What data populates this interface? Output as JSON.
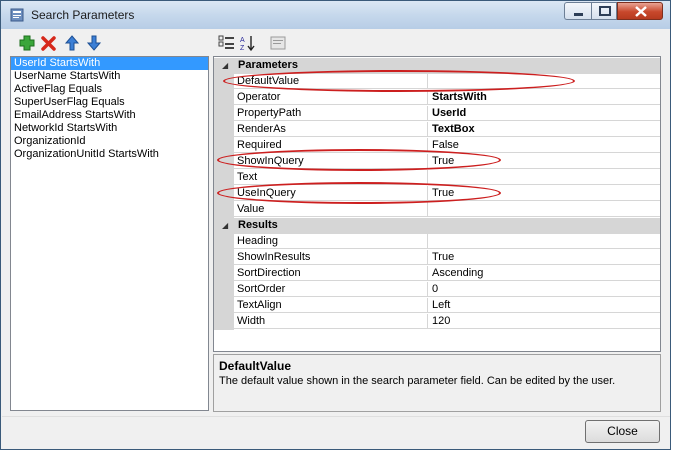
{
  "window": {
    "title": "Search Parameters"
  },
  "list": {
    "items": [
      "UserId StartsWith",
      "UserName StartsWith",
      "ActiveFlag Equals",
      "SuperUserFlag Equals",
      "EmailAddress StartsWith",
      "NetworkId StartsWith",
      "OrganizationId",
      "OrganizationUnitId StartsWith"
    ],
    "selected_index": 0
  },
  "grid": {
    "categories": [
      {
        "label": "Parameters",
        "rows": [
          {
            "name": "DefaultValue",
            "value": ""
          },
          {
            "name": "Operator",
            "value": "StartsWith"
          },
          {
            "name": "PropertyPath",
            "value": "UserId"
          },
          {
            "name": "RenderAs",
            "value": "TextBox"
          },
          {
            "name": "Required",
            "value": "False"
          },
          {
            "name": "ShowInQuery",
            "value": "True"
          },
          {
            "name": "Text",
            "value": ""
          },
          {
            "name": "UseInQuery",
            "value": "True"
          },
          {
            "name": "Value",
            "value": ""
          }
        ]
      },
      {
        "label": "Results",
        "rows": [
          {
            "name": "Heading",
            "value": ""
          },
          {
            "name": "ShowInResults",
            "value": "True"
          },
          {
            "name": "SortDirection",
            "value": "Ascending"
          },
          {
            "name": "SortOrder",
            "value": "0"
          },
          {
            "name": "TextAlign",
            "value": "Left"
          },
          {
            "name": "Width",
            "value": "120"
          }
        ]
      }
    ]
  },
  "help": {
    "title": "DefaultValue",
    "description": "The default value shown in the search parameter field. Can be edited by the user."
  },
  "buttons": {
    "close": "Close"
  },
  "icons": {
    "add": "plus-icon",
    "delete": "delete-icon",
    "up": "arrow-up-icon",
    "down": "arrow-down-icon",
    "categorized": "categorized-icon",
    "alphabetical": "sort-az-icon",
    "property_pages": "property-pages-icon"
  },
  "colors": {
    "selection": "#3399ff",
    "annotation": "#cc1f1f"
  }
}
